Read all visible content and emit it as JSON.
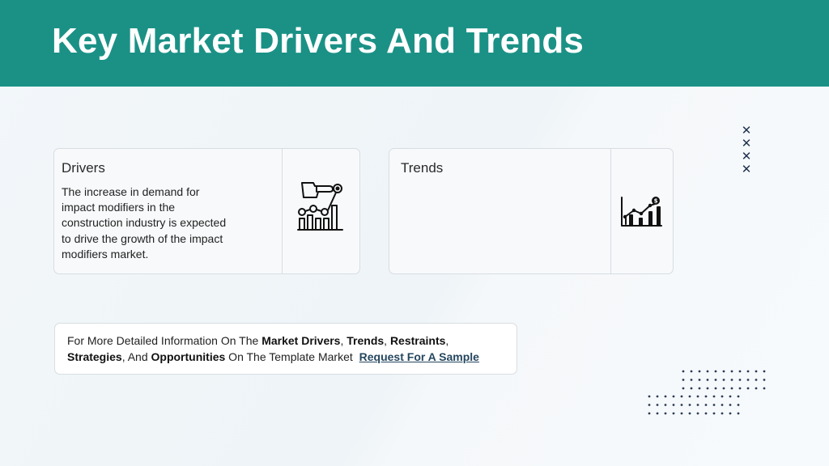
{
  "header": {
    "title": "Key Market Drivers And Trends"
  },
  "drivers": {
    "title": "Drivers",
    "text": "The increase in demand for impact modifiers in the construction industry is expected to drive the growth of the impact modifiers market.",
    "icon": "hand-chart-icon"
  },
  "trends": {
    "title": "Trends",
    "icon": "growth-chart-icon"
  },
  "info": {
    "p1": "For More Detailed Information On The ",
    "b1": "Market Drivers",
    "s1": ", ",
    "b2": "Trends",
    "s2": ", ",
    "b3": "Restraints",
    "s3": ", ",
    "b4": "Strategies",
    "s4": ", And ",
    "b5": "Opportunities",
    "p2": " On The Template Market ",
    "link": "Request For A Sample"
  },
  "colors": {
    "header_bg": "#1b9186",
    "link": "#25475f",
    "x_marks": "#1e2f4d"
  }
}
